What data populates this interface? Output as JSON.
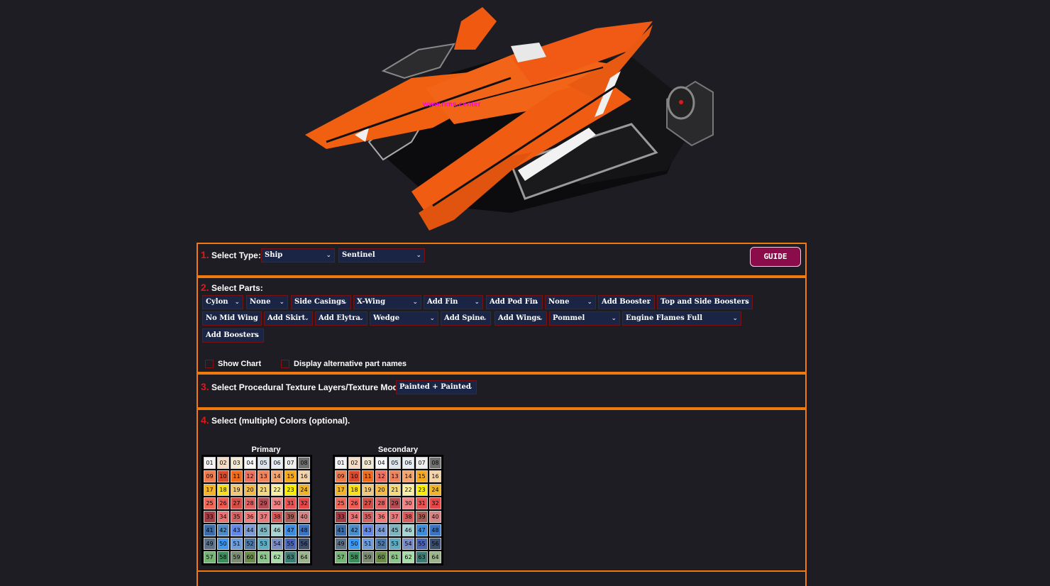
{
  "ship": {
    "watermark": "www.nms.center"
  },
  "step1": {
    "number": "1.",
    "label": "Select Type:",
    "type_value": "Ship",
    "subtype_value": "Sentinel",
    "guide_label": "GUIDE"
  },
  "step2": {
    "number": "2.",
    "label": "Select Parts:",
    "parts": [
      "Cylon",
      "None",
      "Side Casings",
      "X-Wing",
      "Add Fin",
      "Add Pod Fin",
      "None",
      "Add Booster",
      "Top and Side Boosters",
      "No Mid Wing",
      "Add Skirt",
      "Add Elytra",
      "Wedge",
      "Add Spine",
      "Add Wings",
      "Pommel",
      "Engine Flames Full",
      "Add Boosters"
    ],
    "show_chart_label": "Show Chart",
    "alt_names_label": "Display alternative part names"
  },
  "step3": {
    "number": "3.",
    "label": "Select Procedural Texture Layers/Texture Mode:",
    "mode_value": "Painted + Painted"
  },
  "step4": {
    "number": "4.",
    "label": "Select (multiple) Colors (optional).",
    "primary_title": "Primary",
    "secondary_title": "Secondary",
    "swatches": [
      {
        "n": "01",
        "c": "#f4f4f4"
      },
      {
        "n": "02",
        "c": "#f6dcc4"
      },
      {
        "n": "03",
        "c": "#f4ead4"
      },
      {
        "n": "04",
        "c": "#f8f8fa"
      },
      {
        "n": "05",
        "c": "#dce4ee"
      },
      {
        "n": "06",
        "c": "#e8eef6"
      },
      {
        "n": "07",
        "c": "#f0f0f0"
      },
      {
        "n": "08",
        "c": "#707070"
      },
      {
        "n": "09",
        "c": "#f07c4c"
      },
      {
        "n": "10",
        "c": "#d84a2c"
      },
      {
        "n": "11",
        "c": "#f06a1c"
      },
      {
        "n": "12",
        "c": "#f07060"
      },
      {
        "n": "13",
        "c": "#f0825c"
      },
      {
        "n": "14",
        "c": "#f4a46c"
      },
      {
        "n": "15",
        "c": "#f8a81c"
      },
      {
        "n": "16",
        "c": "#f4d4a8"
      },
      {
        "n": "17",
        "c": "#f4b424"
      },
      {
        "n": "18",
        "c": "#f8e01c"
      },
      {
        "n": "19",
        "c": "#f0c878"
      },
      {
        "n": "20",
        "c": "#f4bc44"
      },
      {
        "n": "21",
        "c": "#f4d880"
      },
      {
        "n": "22",
        "c": "#f8f0a0"
      },
      {
        "n": "23",
        "c": "#f8f000"
      },
      {
        "n": "24",
        "c": "#f0b42c"
      },
      {
        "n": "25",
        "c": "#f06858"
      },
      {
        "n": "26",
        "c": "#f05c54"
      },
      {
        "n": "27",
        "c": "#d44c44"
      },
      {
        "n": "28",
        "c": "#e46464"
      },
      {
        "n": "29",
        "c": "#b44c54"
      },
      {
        "n": "30",
        "c": "#f08484"
      },
      {
        "n": "31",
        "c": "#e85454"
      },
      {
        "n": "32",
        "c": "#e44848"
      },
      {
        "n": "33",
        "c": "#a43c44"
      },
      {
        "n": "34",
        "c": "#e87474"
      },
      {
        "n": "35",
        "c": "#d46464"
      },
      {
        "n": "36",
        "c": "#f07c7c"
      },
      {
        "n": "37",
        "c": "#e87c7c"
      },
      {
        "n": "38",
        "c": "#d85c5c"
      },
      {
        "n": "39",
        "c": "#a85c54"
      },
      {
        "n": "40",
        "c": "#d48484"
      },
      {
        "n": "41",
        "c": "#3c6ca8"
      },
      {
        "n": "42",
        "c": "#4c8cc8"
      },
      {
        "n": "43",
        "c": "#6488e8"
      },
      {
        "n": "44",
        "c": "#7c9cd8"
      },
      {
        "n": "45",
        "c": "#7cb4c0"
      },
      {
        "n": "46",
        "c": "#a8d4d4"
      },
      {
        "n": "47",
        "c": "#3c8ce0"
      },
      {
        "n": "48",
        "c": "#3c74c4"
      },
      {
        "n": "49",
        "c": "#5c7088"
      },
      {
        "n": "50",
        "c": "#3c98f0"
      },
      {
        "n": "51",
        "c": "#6c9cdc"
      },
      {
        "n": "52",
        "c": "#4c78a8"
      },
      {
        "n": "53",
        "c": "#5cacc4"
      },
      {
        "n": "54",
        "c": "#7c8cc4"
      },
      {
        "n": "55",
        "c": "#4c64b4"
      },
      {
        "n": "56",
        "c": "#3c4c6c"
      },
      {
        "n": "57",
        "c": "#74b474"
      },
      {
        "n": "58",
        "c": "#3c8c5c"
      },
      {
        "n": "59",
        "c": "#7c8c74"
      },
      {
        "n": "60",
        "c": "#6c8c4c"
      },
      {
        "n": "61",
        "c": "#8cc48c"
      },
      {
        "n": "62",
        "c": "#a8dca8"
      },
      {
        "n": "63",
        "c": "#3c7c74"
      },
      {
        "n": "64",
        "c": "#9cb48c"
      }
    ]
  }
}
